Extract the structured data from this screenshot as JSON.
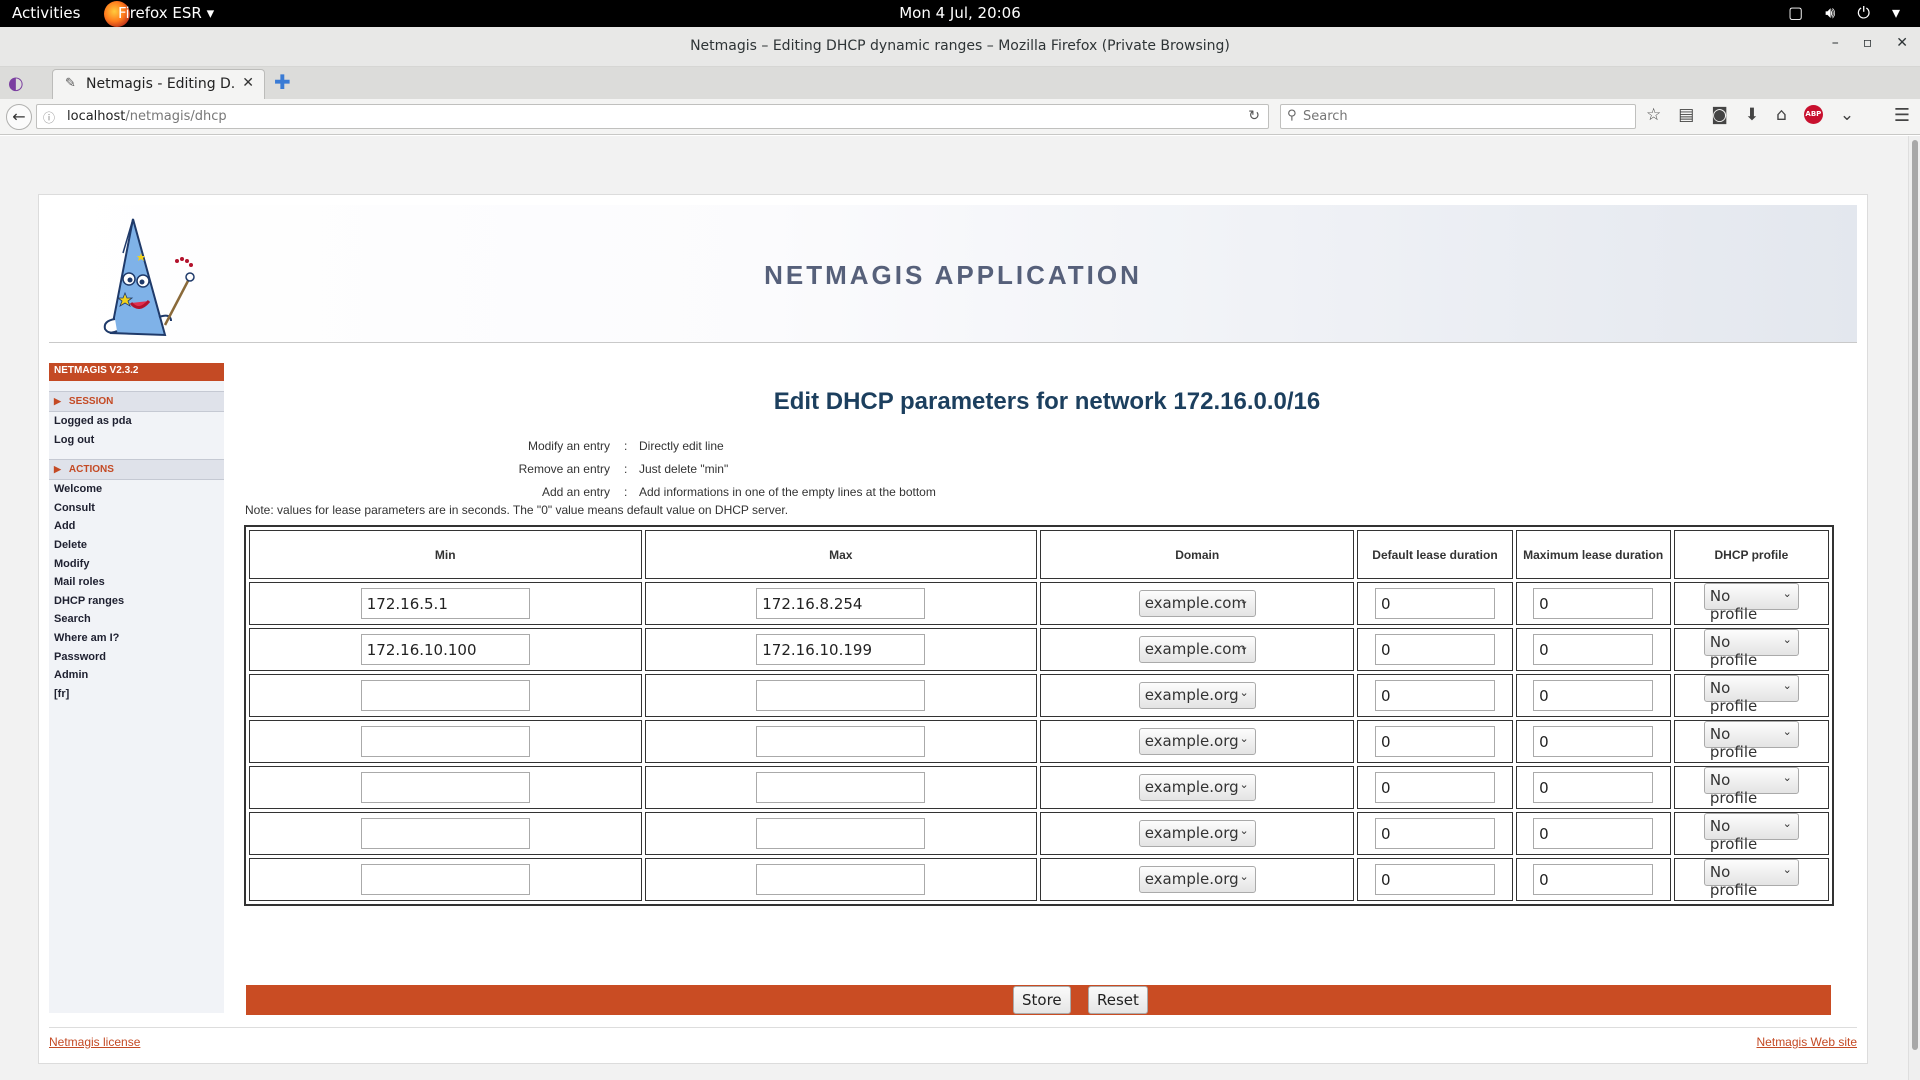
{
  "system": {
    "activities": "Activities",
    "app_name": "Firefox ESR",
    "clock": "Mon  4 Jul, 20:06"
  },
  "window": {
    "title": "Netmagis – Editing DHCP dynamic ranges – Mozilla Firefox (Private Browsing)"
  },
  "tab": {
    "title": "Netmagis - Editing D..."
  },
  "navbar": {
    "url_host": "localhost",
    "url_path": "/netmagis/dhcp",
    "search_placeholder": "Search",
    "abp_label": "ABP"
  },
  "banner": {
    "title": "NETMAGIS APPLICATION"
  },
  "sidebar": {
    "version": "NETMAGIS V2.3.2",
    "session_header": "SESSION",
    "session_items": [
      "Logged as pda",
      "Log out"
    ],
    "actions_header": "ACTIONS",
    "action_items": [
      "Welcome",
      "Consult",
      "Add",
      "Delete",
      "Modify",
      "Mail roles",
      "DHCP ranges",
      "Search",
      "Where am I?",
      "Password",
      "Admin",
      "[fr]"
    ]
  },
  "main": {
    "heading": "Edit DHCP parameters for network 172.16.0.0/16",
    "help": [
      {
        "key": "Modify an entry",
        "sep": ":",
        "value": "Directly edit line"
      },
      {
        "key": "Remove an entry",
        "sep": ":",
        "value": "Just delete \"min\""
      },
      {
        "key": "Add an entry",
        "sep": ":",
        "value": "Add informations in one of the empty lines at the bottom"
      }
    ],
    "note": "Note: values for lease parameters are in seconds. The \"0\" value means default value on DHCP server.",
    "columns": [
      "Min",
      "Max",
      "Domain",
      "Default lease duration",
      "Maximum lease duration",
      "DHCP profile"
    ],
    "rows": [
      {
        "min": "172.16.5.1",
        "max": "172.16.8.254",
        "domain": "example.com",
        "default_lease": "0",
        "max_lease": "0",
        "profile": "No profile"
      },
      {
        "min": "172.16.10.100",
        "max": "172.16.10.199",
        "domain": "example.com",
        "default_lease": "0",
        "max_lease": "0",
        "profile": "No profile"
      },
      {
        "min": "",
        "max": "",
        "domain": "example.org",
        "default_lease": "0",
        "max_lease": "0",
        "profile": "No profile"
      },
      {
        "min": "",
        "max": "",
        "domain": "example.org",
        "default_lease": "0",
        "max_lease": "0",
        "profile": "No profile"
      },
      {
        "min": "",
        "max": "",
        "domain": "example.org",
        "default_lease": "0",
        "max_lease": "0",
        "profile": "No profile"
      },
      {
        "min": "",
        "max": "",
        "domain": "example.org",
        "default_lease": "0",
        "max_lease": "0",
        "profile": "No profile"
      },
      {
        "min": "",
        "max": "",
        "domain": "example.org",
        "default_lease": "0",
        "max_lease": "0",
        "profile": "No profile"
      }
    ],
    "store_label": "Store",
    "reset_label": "Reset"
  },
  "footer": {
    "license": "Netmagis license",
    "website": "Netmagis Web site"
  },
  "colors": {
    "accent": "#c94c23",
    "heading": "#1c3f5e",
    "banner_title": "#56607a"
  }
}
